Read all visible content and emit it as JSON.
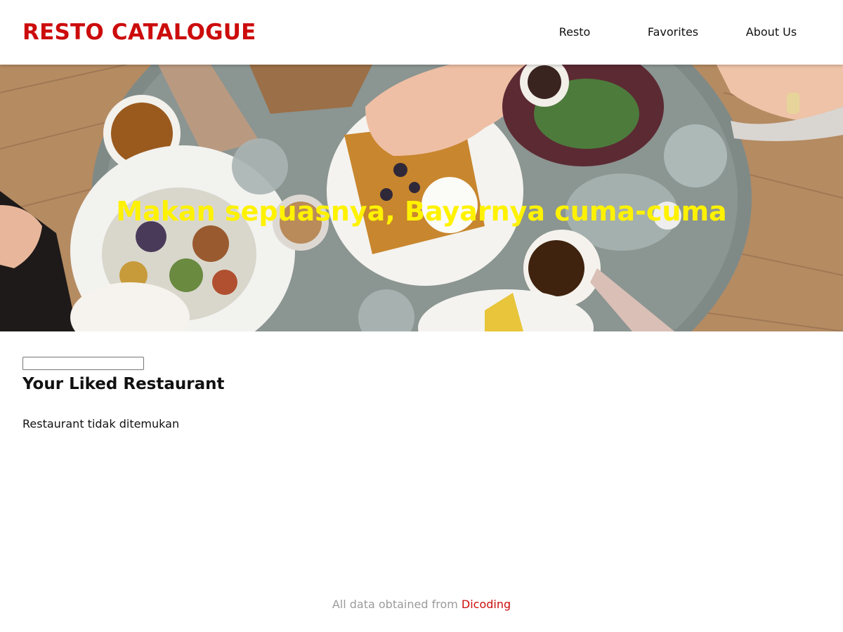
{
  "header": {
    "brand": "RESTO CATALOGUE",
    "nav": [
      {
        "label": "Resto"
      },
      {
        "label": "Favorites"
      },
      {
        "label": "About Us"
      }
    ]
  },
  "hero": {
    "tagline": "Makan sepuasnya, Bayarnya cuma-cuma",
    "image_icon": "restaurant-table-photo"
  },
  "search": {
    "value": "",
    "placeholder": ""
  },
  "main": {
    "title": "Your Liked Restaurant",
    "empty_message": "Restaurant tidak ditemukan"
  },
  "footer": {
    "text": "All data obtained from",
    "link_label": "Dicoding"
  },
  "colors": {
    "brand": "#cc0c0c",
    "tagline": "#fff200",
    "footer_text": "#9b9b9b"
  }
}
